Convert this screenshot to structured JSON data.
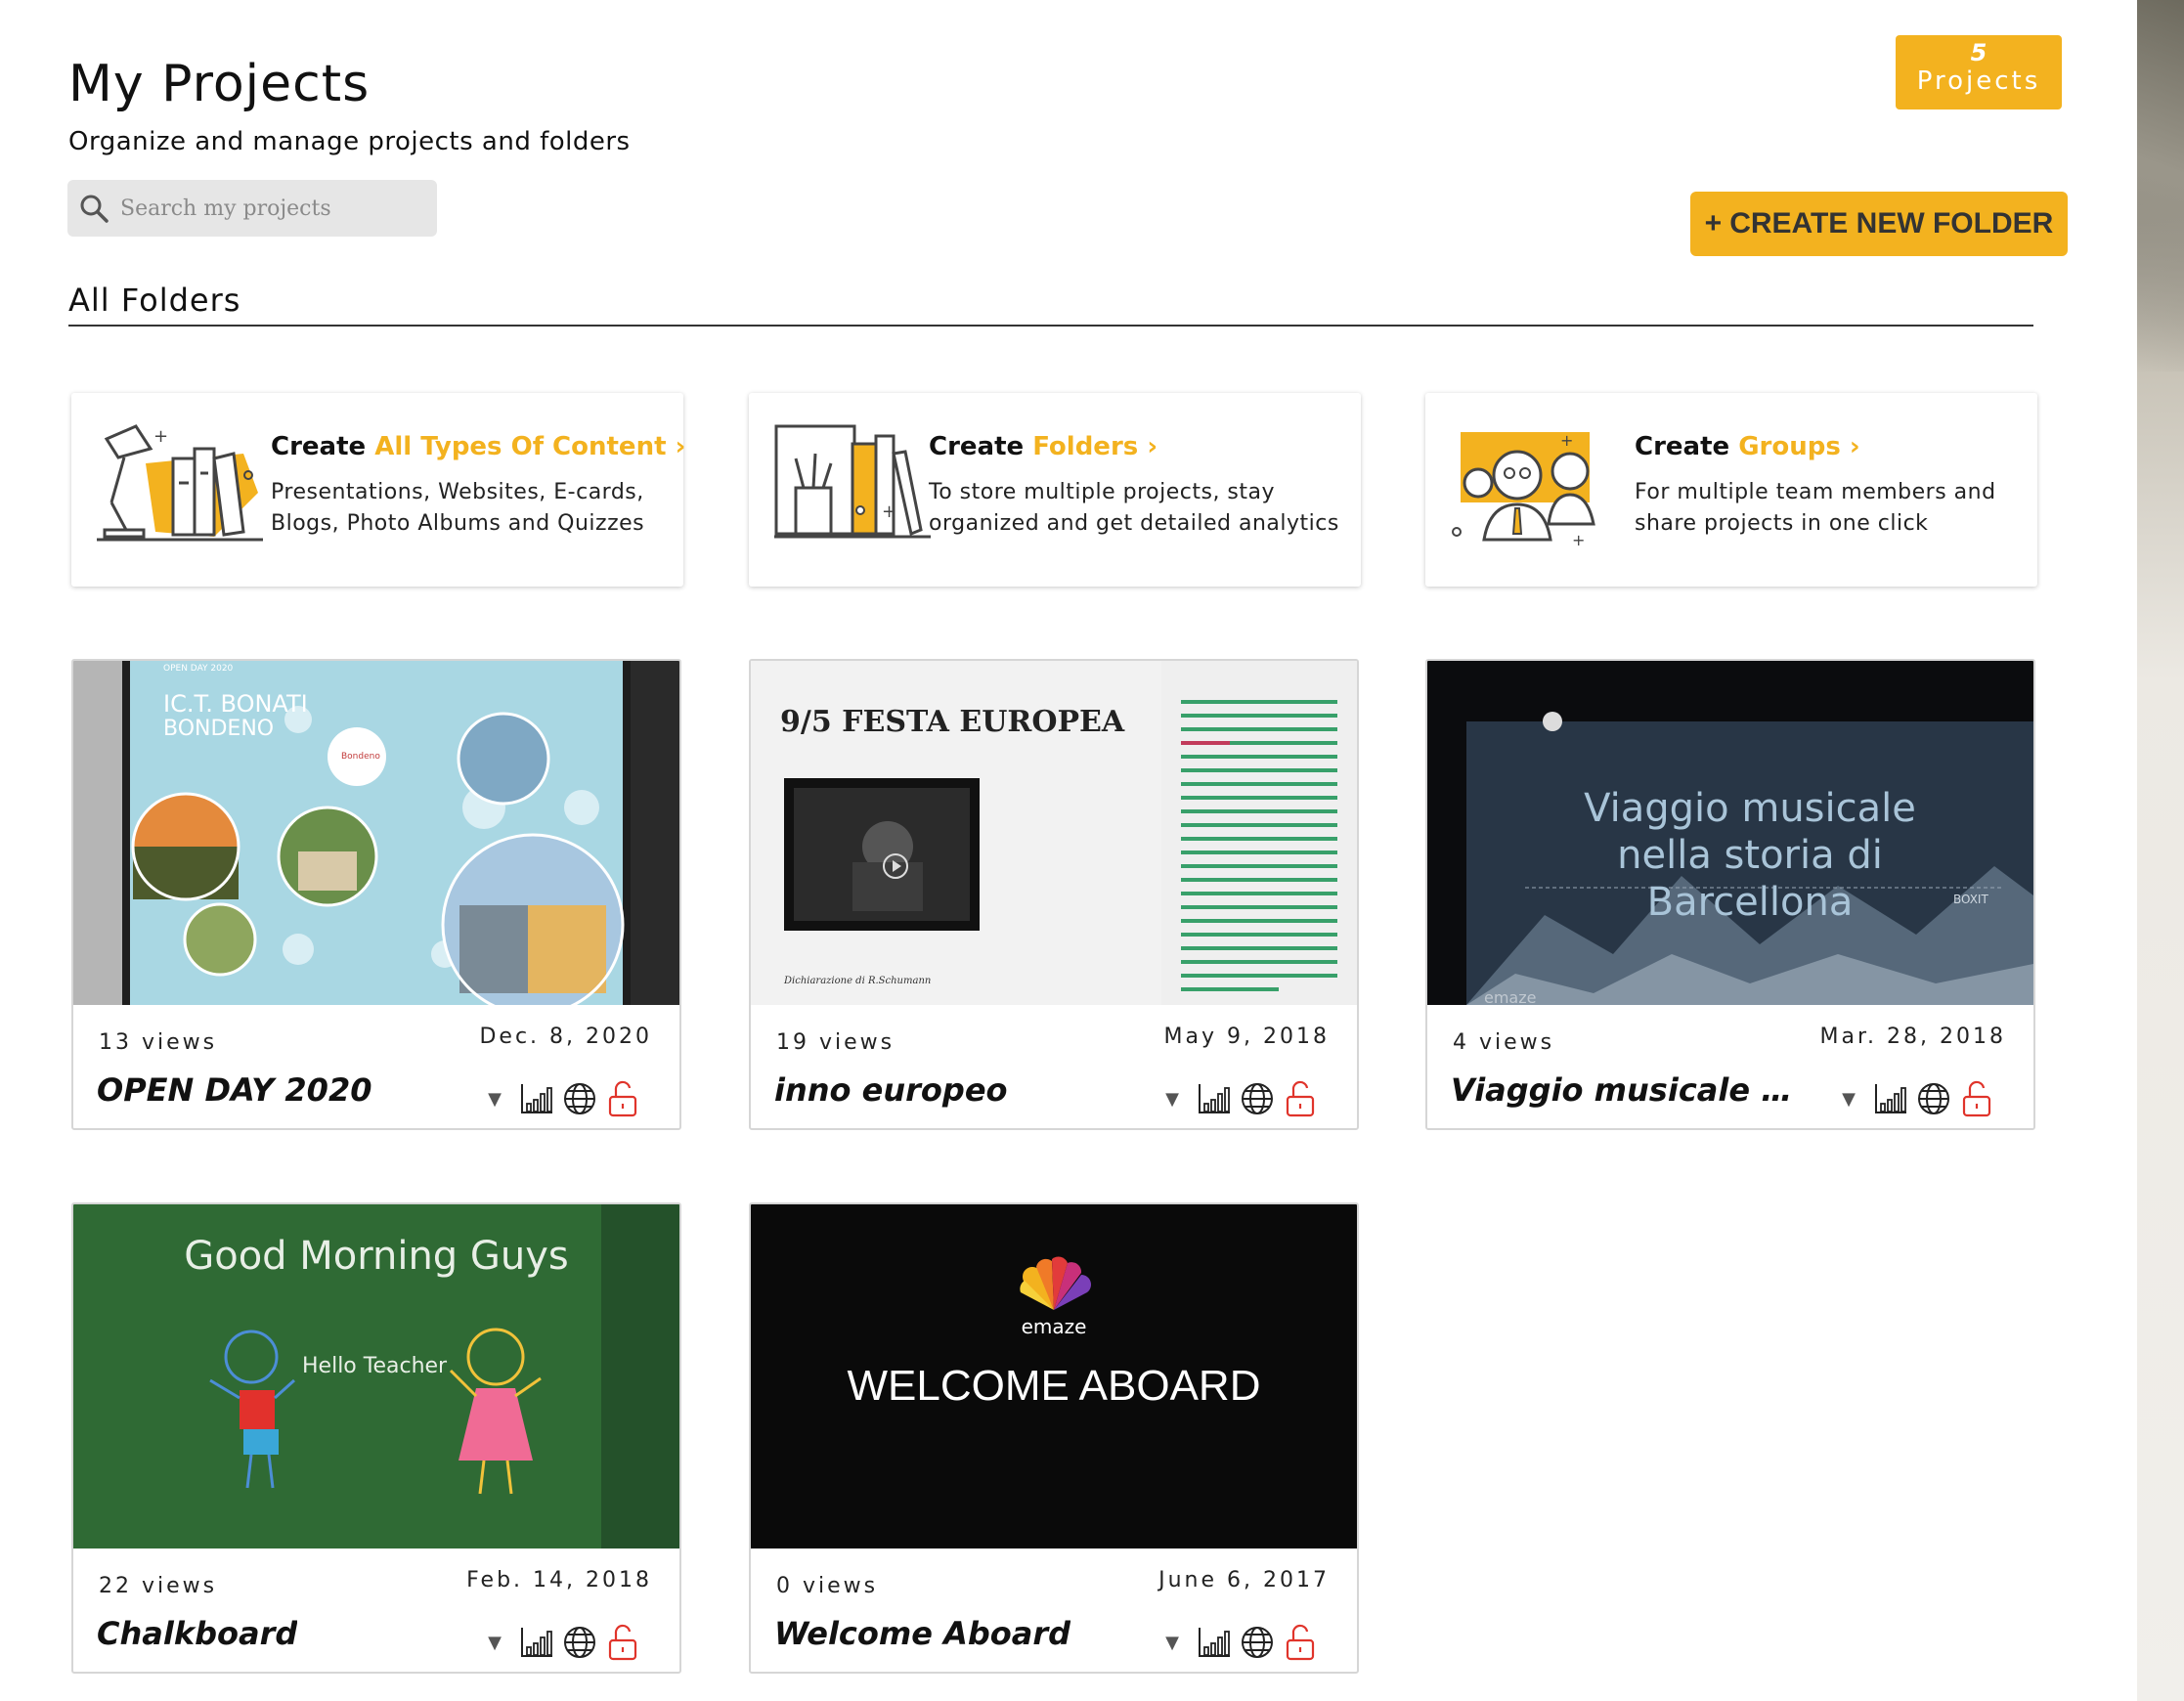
{
  "header": {
    "title": "My Projects",
    "subtitle": "Organize and manage projects and folders",
    "search_placeholder": "Search my projects",
    "badge_count": "5",
    "badge_label": "Projects",
    "create_folder_plus": "+",
    "create_folder_label": "CREATE NEW FOLDER",
    "section_title": "All Folders"
  },
  "promos": [
    {
      "prefix": "Create",
      "highlight": "All Types Of Content",
      "line1": "Presentations, Websites, E-cards,",
      "line2": "Blogs, Photo Albums and Quizzes"
    },
    {
      "prefix": "Create",
      "highlight": "Folders",
      "line1": "To store multiple projects, stay",
      "line2": "organized and get detailed analytics"
    },
    {
      "prefix": "Create",
      "highlight": "Groups",
      "line1": "For multiple team members and",
      "line2": "share projects in one click"
    }
  ],
  "projects": [
    {
      "views": "13 views",
      "date": "Dec. 8, 2020",
      "title": "OPEN DAY 2020",
      "thumb": {
        "tag": "OPEN DAY 2020",
        "line1": "IC.T. BONATI",
        "line2": "BONDENO",
        "logo": "Bondeno"
      }
    },
    {
      "views": "19 views",
      "date": "May 9, 2018",
      "title": "inno europeo",
      "thumb": {
        "heading": "9/5 FESTA EUROPEA",
        "caption": "Dichiarazione di R.Schumann"
      }
    },
    {
      "views": "4 views",
      "date": "Mar. 28, 2018",
      "title": "Viaggio musicale n...",
      "thumb": {
        "line1": "Viaggio musicale",
        "line2": "nella storia di",
        "line3": "Barcellona",
        "tag": "BOXIT",
        "brand": "emaze"
      }
    },
    {
      "views": "22 views",
      "date": "Feb. 14, 2018",
      "title": "Chalkboard",
      "thumb": {
        "heading": "Good Morning Guys",
        "bubble": "Hello Teacher"
      }
    },
    {
      "views": "0 views",
      "date": "June 6, 2017",
      "title": "Welcome Aboard",
      "thumb": {
        "brand": "emaze",
        "heading": "WELCOME ABOARD"
      }
    }
  ],
  "colors": {
    "accent": "#f3b21f",
    "lock": "#e0342b"
  },
  "icons": [
    "search-icon",
    "dropdown-arrow-icon",
    "analytics-icon",
    "globe-icon",
    "unlock-icon"
  ]
}
